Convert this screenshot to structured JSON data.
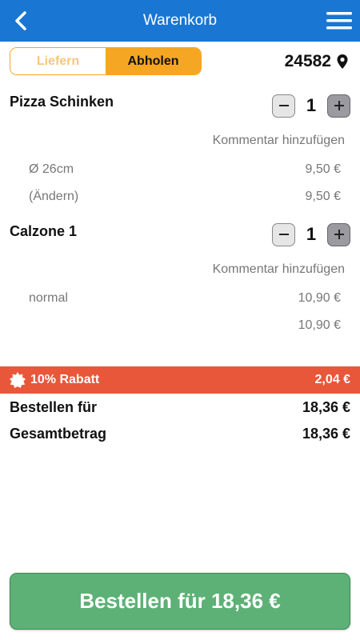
{
  "header": {
    "title": "Warenkorb",
    "back_icon": "chevron-left-icon",
    "menu_icon": "hamburger-icon",
    "color": "#1976d2"
  },
  "delivery": {
    "options": [
      "Liefern",
      "Abholen"
    ],
    "selected": "Abholen",
    "zip": "24582",
    "location_icon": "location-pin-icon"
  },
  "items": [
    {
      "name": "Pizza Schinken",
      "qty": "1",
      "comment_link": "Kommentar hinzufügen",
      "options": [
        {
          "label": "Ø 26cm",
          "price": "9,50 €"
        },
        {
          "label": "(Ändern)",
          "price": "9,50 €"
        }
      ]
    },
    {
      "name": "Calzone 1",
      "qty": "1",
      "comment_link": "Kommentar hinzufügen",
      "options": [
        {
          "label": "normal",
          "price": "10,90 €"
        },
        {
          "label": "",
          "price": "10,90 €"
        }
      ]
    }
  ],
  "discount": {
    "label": "10% Rabatt",
    "value": "2,04 €",
    "icon": "badge-icon",
    "color": "#e8573a"
  },
  "totals": {
    "order_label": "Bestellen für",
    "order_value": "18,36 €",
    "total_label": "Gesamtbetrag",
    "total_value": "18,36 €"
  },
  "order_button": {
    "label": "Bestellen für 18,36 €",
    "color": "#5db176"
  }
}
